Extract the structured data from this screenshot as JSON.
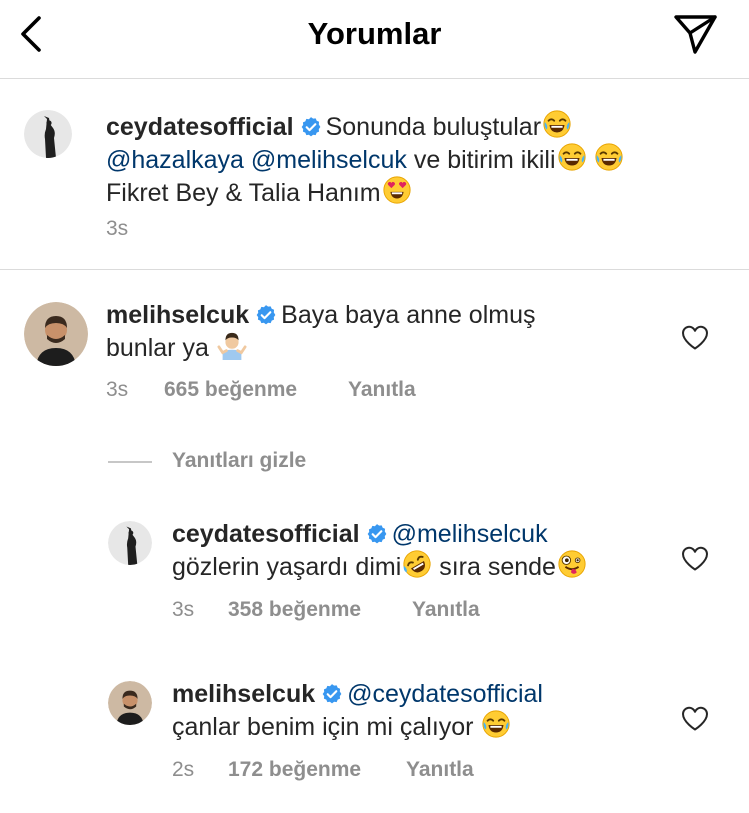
{
  "header": {
    "title": "Yorumlar",
    "back_icon": "chevron-left-icon",
    "send_icon": "paper-plane-icon"
  },
  "caption": {
    "username": "ceydatesofficial",
    "verified": true,
    "text_part1": "Sonunda buluştular",
    "mention1": "@hazalkaya",
    "mention2": "@melihselcuk",
    "text_part2": "ve  bitirim ikili",
    "text_part3": "Fikret Bey & Talia Hanım",
    "time": "3s"
  },
  "comments": [
    {
      "username": "melihselcuk",
      "verified": true,
      "text_line1": "Baya baya anne olmuş",
      "text_line2": "bunlar ya",
      "time": "3s",
      "likes": "665 beğenme",
      "reply_label": "Yanıtla"
    }
  ],
  "hide_replies_label": "Yanıtları gizle",
  "replies": [
    {
      "username": "ceydatesofficial",
      "verified": true,
      "mention": "@melihselcuk",
      "text_part1": "gözlerin yaşardı dimi",
      "text_part2": " sıra sende",
      "time": "3s",
      "likes": "358 beğenme",
      "reply_label": "Yanıtla"
    },
    {
      "username": "melihselcuk",
      "verified": true,
      "mention": "@ceydatesofficial",
      "text_part1": "çanlar benim için mi çalıyor ",
      "time": "2s",
      "likes": "172 beğenme",
      "reply_label": "Yanıtla"
    }
  ],
  "colors": {
    "verified_blue": "#3897f0",
    "mention_blue": "#00376b",
    "meta_gray": "#8e8e8e",
    "divider": "#dbdbdb"
  }
}
